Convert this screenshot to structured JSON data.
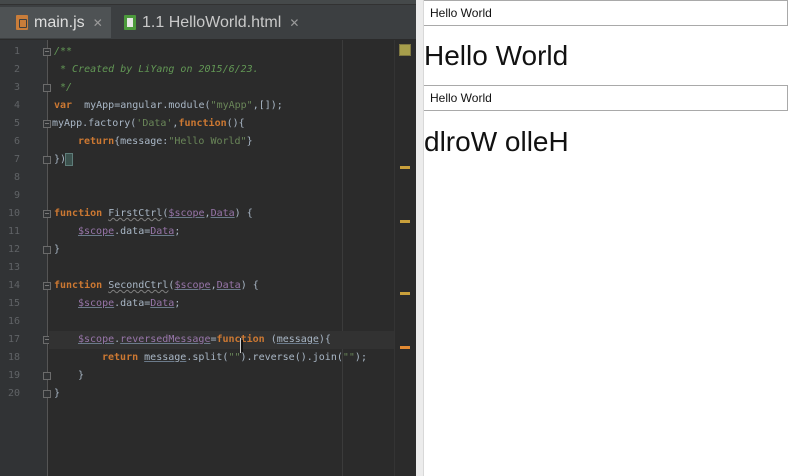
{
  "editor": {
    "tabs": [
      {
        "label": "main.js",
        "icon": "js-file-icon",
        "active": true
      },
      {
        "label": "1.1 HelloWorld.html",
        "icon": "html-file-icon",
        "active": false
      }
    ],
    "line_numbers": [
      "1",
      "2",
      "3",
      "4",
      "5",
      "6",
      "7",
      "8",
      "9",
      "10",
      "11",
      "12",
      "13",
      "14",
      "15",
      "16",
      "17",
      "18",
      "19",
      "20"
    ],
    "colors": {
      "keyword": "#cc7832",
      "comment": "#629755",
      "string": "#6a8759",
      "function": "#ffc66d",
      "variable": "#9876aa",
      "text": "#a9b7c6"
    },
    "code": {
      "l1": "/**",
      "l2": " * Created by LiYang on 2015/6/23.",
      "l3": " */",
      "l4": {
        "kw": "var",
        "rest1": "  myApp=angular.module(",
        "str": "\"myApp\"",
        "rest2": ",[]);"
      },
      "l5": {
        "a": "myApp.factory(",
        "str1": "'Data'",
        "b": ",",
        "kw": "function",
        "c": "(){"
      },
      "l6": {
        "kw": "return",
        "a": "{message:",
        "str": "\"Hello World\"",
        "b": "}"
      },
      "l7": "})",
      "l10": {
        "kw": "function",
        "name": "FirstCtrl",
        "p1": "$scope",
        "p2": "Data",
        "tail": ") {"
      },
      "l11": {
        "a": "$scope",
        "b": ".data=",
        "c": "Data",
        "d": ";"
      },
      "l12": "}",
      "l14": {
        "kw": "function",
        "name": "SecondCtrl",
        "p1": "$scope",
        "p2": "Data",
        "tail": ") {"
      },
      "l15": {
        "a": "$scope",
        "b": ".data=",
        "c": "Data",
        "d": ";"
      },
      "l17": {
        "a": "$scope",
        "b": ".",
        "prop": "reversedMessage",
        "c": "=",
        "kw": "function",
        "p": "message",
        "tail": "){"
      },
      "l18": {
        "kw": "return",
        "a": "message",
        "b": ".split(",
        "s1": "\"\"",
        "c": ").reverse().join(",
        "s2": "\"\"",
        "d": ");"
      },
      "l19": "}",
      "l20": "}"
    }
  },
  "preview": {
    "input1_value": "Hello World",
    "heading1": "Hello World",
    "input2_value": "Hello World",
    "heading2": "dlroW olleH"
  }
}
